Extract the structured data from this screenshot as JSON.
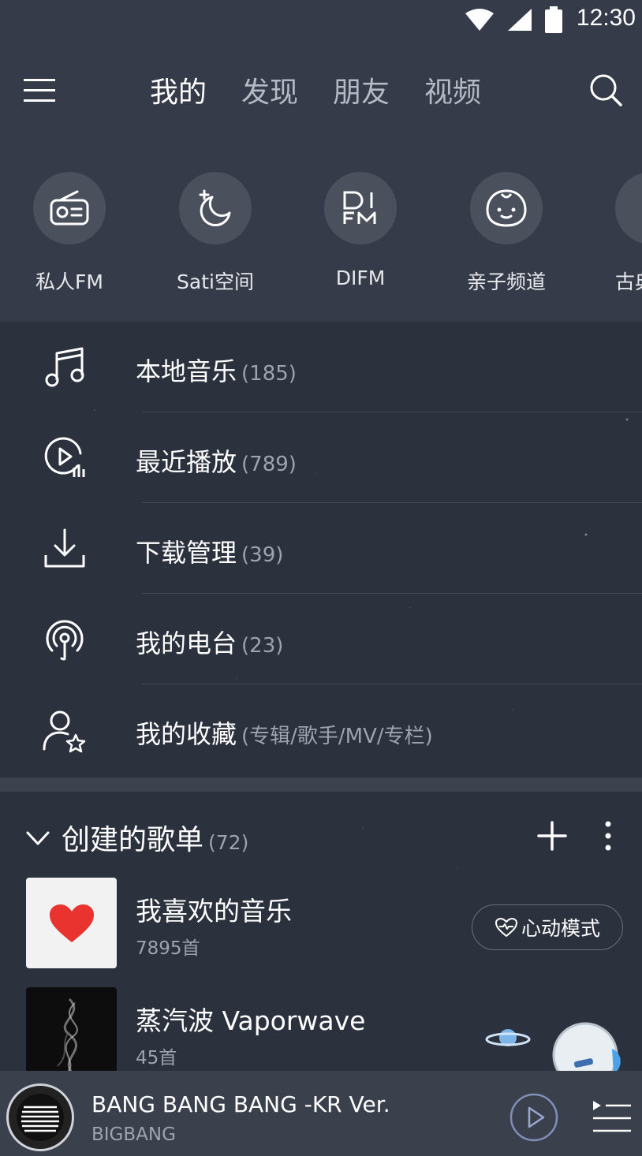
{
  "status_bar": {
    "time": "12:30"
  },
  "nav": {
    "tabs": [
      {
        "label": "我的",
        "active": true
      },
      {
        "label": "发现",
        "active": false
      },
      {
        "label": "朋友",
        "active": false
      },
      {
        "label": "视频",
        "active": false
      }
    ]
  },
  "shortcuts": [
    {
      "label": "私人FM",
      "icon": "radio-icon"
    },
    {
      "label": "Sati空间",
      "icon": "moon-icon"
    },
    {
      "label": "DIFM",
      "icon": "difm-icon"
    },
    {
      "label": "亲子频道",
      "icon": "baby-icon"
    },
    {
      "label": "古典",
      "icon": "classical-icon"
    }
  ],
  "menu": [
    {
      "label": "本地音乐",
      "count": "(185)",
      "icon": "music-note-icon"
    },
    {
      "label": "最近播放",
      "count": "(789)",
      "icon": "recent-play-icon"
    },
    {
      "label": "下载管理",
      "count": "(39)",
      "icon": "download-icon"
    },
    {
      "label": "我的电台",
      "count": "(23)",
      "icon": "podcast-icon"
    },
    {
      "label": "我的收藏",
      "count": "(专辑/歌手/MV/专栏)",
      "icon": "user-star-icon"
    }
  ],
  "playlists_section": {
    "title": "创建的歌单",
    "count": "(72)",
    "items": [
      {
        "name": "我喜欢的音乐",
        "songs": "7895首",
        "cover": "heart-cover"
      },
      {
        "name": "蒸汽波 Vaporwave",
        "songs": "45首",
        "cover": "smoke-cover"
      }
    ],
    "heartbeat_label": "心动模式"
  },
  "player": {
    "title": "BANG BANG BANG -KR Ver.",
    "artist": "BIGBANG"
  },
  "colors": {
    "background": "#2b313d",
    "header": "#353b48",
    "accent_heart": "#e8332f"
  }
}
